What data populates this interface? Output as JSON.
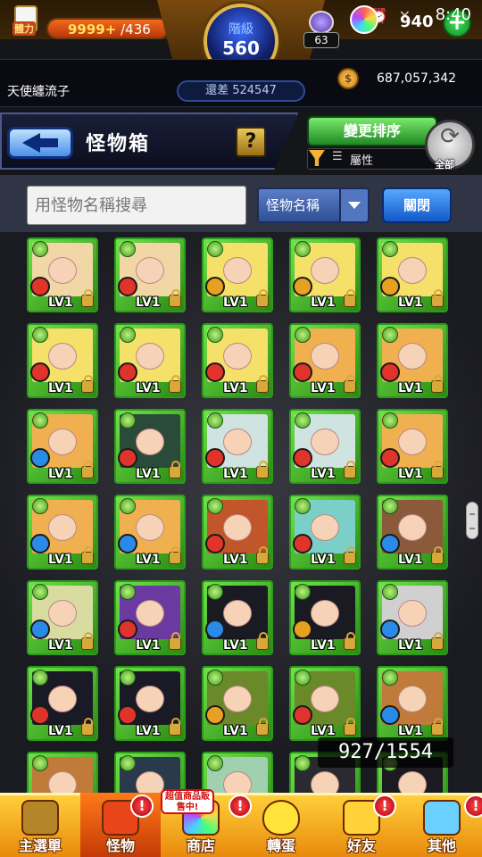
{
  "status_bar": {
    "time": "8:40",
    "stamina_tag": "體力",
    "stamina_current": "9999+",
    "stamina_max": "/436",
    "orb_count": "940",
    "plus_label": "+",
    "mini_badge": "63"
  },
  "rank": {
    "label": "階級",
    "value": "560",
    "exp_remaining": "還差 524547"
  },
  "user": {
    "name": "天使纏流子",
    "coins": "687,057,342"
  },
  "header": {
    "title": "怪物箱",
    "help_label": "?",
    "sort_label": "變更排序",
    "filter_label": "屬性",
    "all_label": "全部"
  },
  "search": {
    "placeholder": "用怪物名稱搜尋",
    "dropdown_value": "怪物名稱",
    "close_label": "關閉"
  },
  "inventory": {
    "count": "927/1554"
  },
  "cards": [
    {
      "level": "LV1",
      "element": "fire",
      "art": "#f2d7a6"
    },
    {
      "level": "LV1",
      "element": "fire",
      "art": "#f2d7a6"
    },
    {
      "level": "LV1",
      "element": "wood",
      "art": "#f5e06a"
    },
    {
      "level": "LV1",
      "element": "wood",
      "art": "#f5e06a"
    },
    {
      "level": "LV1",
      "element": "wood",
      "art": "#f5e06a"
    },
    {
      "level": "LV1",
      "element": "fire",
      "art": "#f5e06a"
    },
    {
      "level": "LV1",
      "element": "fire",
      "art": "#f5e06a"
    },
    {
      "level": "LV1",
      "element": "fire",
      "art": "#f5e06a"
    },
    {
      "level": "LV1",
      "element": "fire",
      "art": "#f0b050"
    },
    {
      "level": "LV1",
      "element": "fire",
      "art": "#f0b050"
    },
    {
      "level": "LV1",
      "element": "water",
      "art": "#f0b050"
    },
    {
      "level": "LV1",
      "element": "fire",
      "art": "#2a4a3a"
    },
    {
      "level": "LV1",
      "element": "fire",
      "art": "#cfe3e0"
    },
    {
      "level": "LV1",
      "element": "fire",
      "art": "#cfe3e0"
    },
    {
      "level": "LV1",
      "element": "fire",
      "art": "#f0b050"
    },
    {
      "level": "LV1",
      "element": "water",
      "art": "#f0b050"
    },
    {
      "level": "LV1",
      "element": "water",
      "art": "#f0b050"
    },
    {
      "level": "LV1",
      "element": "fire",
      "art": "#c0562a"
    },
    {
      "level": "LV1",
      "element": "fire",
      "art": "#7ad0c8"
    },
    {
      "level": "LV1",
      "element": "water",
      "art": "#8a5a3a"
    },
    {
      "level": "LV1",
      "element": "water",
      "art": "#d8dca0"
    },
    {
      "level": "LV1",
      "element": "fire",
      "art": "#6a3aa0"
    },
    {
      "level": "LV1",
      "element": "water",
      "art": "#1a1a22"
    },
    {
      "level": "LV1",
      "element": "wood",
      "art": "#1a1a22"
    },
    {
      "level": "LV1",
      "element": "water",
      "art": "#d0d0d0"
    },
    {
      "level": "LV1",
      "element": "fire",
      "art": "#1a1a26"
    },
    {
      "level": "LV1",
      "element": "fire",
      "art": "#1a1a26"
    },
    {
      "level": "LV1",
      "element": "wood",
      "art": "#6a8a2a"
    },
    {
      "level": "LV1",
      "element": "fire",
      "art": "#6a8a2a"
    },
    {
      "level": "LV1",
      "element": "water",
      "art": "#c07a3a"
    },
    {
      "level": "",
      "element": "",
      "art": "#c07a3a"
    },
    {
      "level": "",
      "element": "",
      "art": "#2a3a4a"
    },
    {
      "level": "",
      "element": "",
      "art": "#a0d0b0"
    },
    {
      "level": "",
      "element": "",
      "art": "#2a2a30"
    },
    {
      "level": "",
      "element": "",
      "art": "#1a1a20"
    }
  ],
  "colors": {
    "fire": "#e0342a",
    "water": "#2a8ae8",
    "wood": "#e8a020"
  },
  "nav": [
    {
      "label": "主選單",
      "icon": "castle-icon",
      "alert": false
    },
    {
      "label": "怪物",
      "icon": "monster-icon",
      "alert": true
    },
    {
      "label": "商店",
      "icon": "shop-orb-icon",
      "alert": true
    },
    {
      "label": "轉蛋",
      "icon": "egg-icon",
      "alert": false
    },
    {
      "label": "好友",
      "icon": "friends-icon",
      "alert": true
    },
    {
      "label": "其他",
      "icon": "question-icon",
      "alert": true
    }
  ],
  "shop_banner": "超值商品販售中!"
}
